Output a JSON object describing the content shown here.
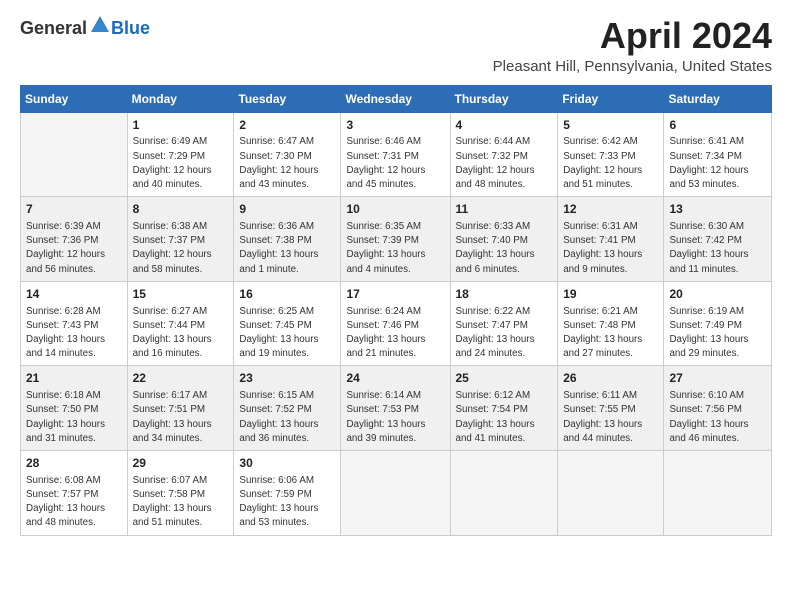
{
  "logo": {
    "general": "General",
    "blue": "Blue"
  },
  "title": "April 2024",
  "location": "Pleasant Hill, Pennsylvania, United States",
  "days_of_week": [
    "Sunday",
    "Monday",
    "Tuesday",
    "Wednesday",
    "Thursday",
    "Friday",
    "Saturday"
  ],
  "weeks": [
    [
      {
        "day": "",
        "info": ""
      },
      {
        "day": "1",
        "info": "Sunrise: 6:49 AM\nSunset: 7:29 PM\nDaylight: 12 hours\nand 40 minutes."
      },
      {
        "day": "2",
        "info": "Sunrise: 6:47 AM\nSunset: 7:30 PM\nDaylight: 12 hours\nand 43 minutes."
      },
      {
        "day": "3",
        "info": "Sunrise: 6:46 AM\nSunset: 7:31 PM\nDaylight: 12 hours\nand 45 minutes."
      },
      {
        "day": "4",
        "info": "Sunrise: 6:44 AM\nSunset: 7:32 PM\nDaylight: 12 hours\nand 48 minutes."
      },
      {
        "day": "5",
        "info": "Sunrise: 6:42 AM\nSunset: 7:33 PM\nDaylight: 12 hours\nand 51 minutes."
      },
      {
        "day": "6",
        "info": "Sunrise: 6:41 AM\nSunset: 7:34 PM\nDaylight: 12 hours\nand 53 minutes."
      }
    ],
    [
      {
        "day": "7",
        "info": "Sunrise: 6:39 AM\nSunset: 7:36 PM\nDaylight: 12 hours\nand 56 minutes."
      },
      {
        "day": "8",
        "info": "Sunrise: 6:38 AM\nSunset: 7:37 PM\nDaylight: 12 hours\nand 58 minutes."
      },
      {
        "day": "9",
        "info": "Sunrise: 6:36 AM\nSunset: 7:38 PM\nDaylight: 13 hours\nand 1 minute."
      },
      {
        "day": "10",
        "info": "Sunrise: 6:35 AM\nSunset: 7:39 PM\nDaylight: 13 hours\nand 4 minutes."
      },
      {
        "day": "11",
        "info": "Sunrise: 6:33 AM\nSunset: 7:40 PM\nDaylight: 13 hours\nand 6 minutes."
      },
      {
        "day": "12",
        "info": "Sunrise: 6:31 AM\nSunset: 7:41 PM\nDaylight: 13 hours\nand 9 minutes."
      },
      {
        "day": "13",
        "info": "Sunrise: 6:30 AM\nSunset: 7:42 PM\nDaylight: 13 hours\nand 11 minutes."
      }
    ],
    [
      {
        "day": "14",
        "info": "Sunrise: 6:28 AM\nSunset: 7:43 PM\nDaylight: 13 hours\nand 14 minutes."
      },
      {
        "day": "15",
        "info": "Sunrise: 6:27 AM\nSunset: 7:44 PM\nDaylight: 13 hours\nand 16 minutes."
      },
      {
        "day": "16",
        "info": "Sunrise: 6:25 AM\nSunset: 7:45 PM\nDaylight: 13 hours\nand 19 minutes."
      },
      {
        "day": "17",
        "info": "Sunrise: 6:24 AM\nSunset: 7:46 PM\nDaylight: 13 hours\nand 21 minutes."
      },
      {
        "day": "18",
        "info": "Sunrise: 6:22 AM\nSunset: 7:47 PM\nDaylight: 13 hours\nand 24 minutes."
      },
      {
        "day": "19",
        "info": "Sunrise: 6:21 AM\nSunset: 7:48 PM\nDaylight: 13 hours\nand 27 minutes."
      },
      {
        "day": "20",
        "info": "Sunrise: 6:19 AM\nSunset: 7:49 PM\nDaylight: 13 hours\nand 29 minutes."
      }
    ],
    [
      {
        "day": "21",
        "info": "Sunrise: 6:18 AM\nSunset: 7:50 PM\nDaylight: 13 hours\nand 31 minutes."
      },
      {
        "day": "22",
        "info": "Sunrise: 6:17 AM\nSunset: 7:51 PM\nDaylight: 13 hours\nand 34 minutes."
      },
      {
        "day": "23",
        "info": "Sunrise: 6:15 AM\nSunset: 7:52 PM\nDaylight: 13 hours\nand 36 minutes."
      },
      {
        "day": "24",
        "info": "Sunrise: 6:14 AM\nSunset: 7:53 PM\nDaylight: 13 hours\nand 39 minutes."
      },
      {
        "day": "25",
        "info": "Sunrise: 6:12 AM\nSunset: 7:54 PM\nDaylight: 13 hours\nand 41 minutes."
      },
      {
        "day": "26",
        "info": "Sunrise: 6:11 AM\nSunset: 7:55 PM\nDaylight: 13 hours\nand 44 minutes."
      },
      {
        "day": "27",
        "info": "Sunrise: 6:10 AM\nSunset: 7:56 PM\nDaylight: 13 hours\nand 46 minutes."
      }
    ],
    [
      {
        "day": "28",
        "info": "Sunrise: 6:08 AM\nSunset: 7:57 PM\nDaylight: 13 hours\nand 48 minutes."
      },
      {
        "day": "29",
        "info": "Sunrise: 6:07 AM\nSunset: 7:58 PM\nDaylight: 13 hours\nand 51 minutes."
      },
      {
        "day": "30",
        "info": "Sunrise: 6:06 AM\nSunset: 7:59 PM\nDaylight: 13 hours\nand 53 minutes."
      },
      {
        "day": "",
        "info": ""
      },
      {
        "day": "",
        "info": ""
      },
      {
        "day": "",
        "info": ""
      },
      {
        "day": "",
        "info": ""
      }
    ]
  ]
}
